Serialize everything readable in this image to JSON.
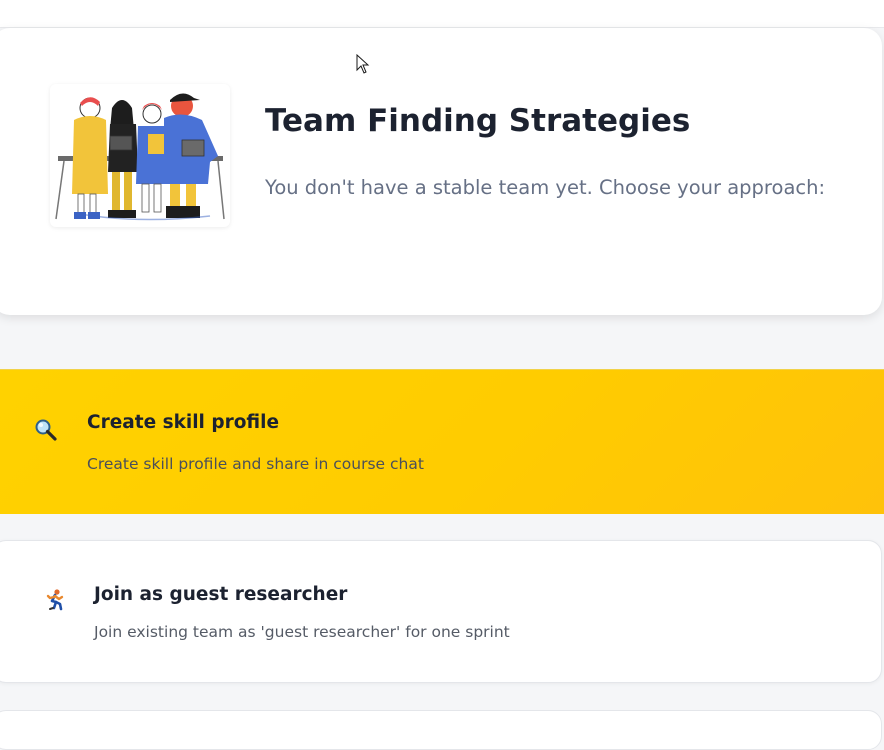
{
  "header": {
    "title": "Team Finding Strategies",
    "subtitle": "You don't have a stable team yet. Choose your approach:",
    "illustration": "team-people-illustration"
  },
  "strategies": [
    {
      "icon": "magnifying-glass-icon",
      "title": "Create skill profile",
      "description": "Create skill profile and share in course chat",
      "highlighted": true
    },
    {
      "icon": "running-person-icon",
      "title": "Join as guest researcher",
      "description": "Join existing team as 'guest researcher' for one sprint",
      "highlighted": false
    }
  ],
  "colors": {
    "accent": "#ffcc00",
    "title": "#1c2230",
    "subtitle": "#667085",
    "background": "#f5f6f8"
  }
}
